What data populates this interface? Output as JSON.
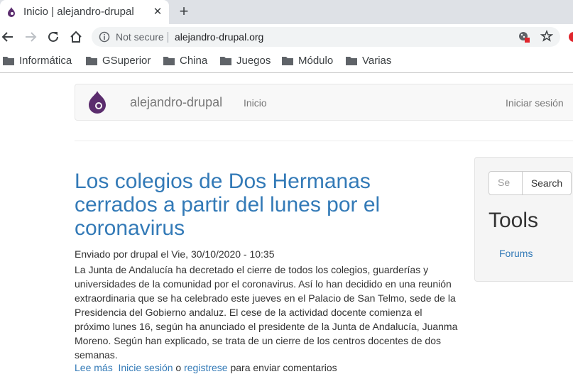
{
  "browser": {
    "tab_title": "Inicio | alejandro-drupal",
    "tab_close": "✕",
    "new_tab": "+",
    "security_label": "Not secure",
    "url": "alejandro-drupal.org",
    "bookmarks": [
      "Informática",
      "GSuperior",
      "China",
      "Juegos",
      "Módulo",
      "Varias"
    ]
  },
  "site": {
    "name": "alejandro-drupal",
    "nav_home": "Inicio",
    "nav_login": "Iniciar sesión"
  },
  "article": {
    "title": "Los colegios de Dos Hermanas cerrados a partir del lunes por el coronavirus",
    "meta": "Enviado por drupal el Vie, 30/10/2020 - 10:35",
    "body": "La Junta de Andalucía ha decretado el cierre de todos los colegios, guarderías y universidades de la comunidad por el coronavirus. Así lo han decidido en una reunión extraordinaria que se ha celebrado este jueves en el Palacio de San Telmo, sede de la Presidencia del Gobierno andaluz. El cese de la actividad docente comienza el próximo lunes 16, según ha anunciado el presidente de la Junta de Andalucía, Juanma Moreno. Según han explicado, se trata de un cierre de los centros docentes de dos semanas.",
    "read_more": "Lee más",
    "login_link": "Inicie sesión",
    "or_text": " o ",
    "register_link": "registrese",
    "comment_suffix": " para enviar comentarios"
  },
  "sidebar": {
    "search_placeholder": "Se",
    "search_button": "Search",
    "tools_title": "Tools",
    "forums_link": "Forums"
  },
  "colors": {
    "link": "#337ab7",
    "drupal_purple": "#5b2d6e"
  }
}
